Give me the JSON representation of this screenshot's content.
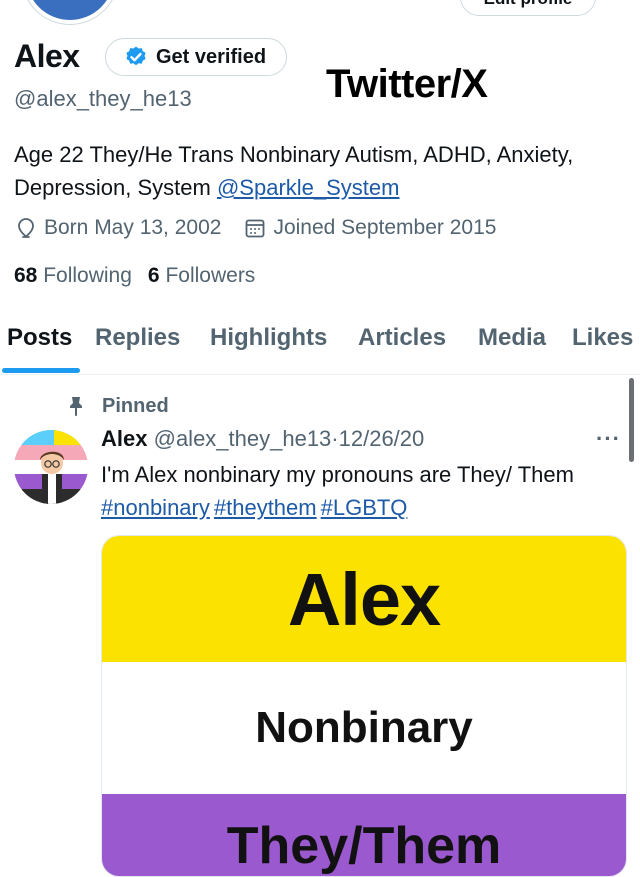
{
  "profile": {
    "edit_button_label": "Edit profile",
    "display_name": "Alex",
    "verify_label": "Get verified",
    "handle": "@alex_they_he13",
    "bio_text": "Age 22 They/He Trans Nonbinary Autism, ADHD, Anxiety, Depression, System ",
    "bio_mention": "@Sparkle_System",
    "born": "Born May 13, 2002",
    "joined": "Joined September 2015",
    "following_count": "68",
    "following_label": "Following",
    "followers_count": "6",
    "followers_label": "Followers"
  },
  "overlay": {
    "app_label": "Twitter/X"
  },
  "tabs": [
    {
      "label": "Posts"
    },
    {
      "label": "Replies"
    },
    {
      "label": "Highlights"
    },
    {
      "label": "Articles"
    },
    {
      "label": "Media"
    },
    {
      "label": "Likes"
    }
  ],
  "post": {
    "pinned_label": "Pinned",
    "author": "Alex",
    "handle": "@alex_they_he13",
    "separator": "·",
    "date": "12/26/20",
    "more_label": "···",
    "text": "I'm Alex nonbinary my pronouns are They/ Them ",
    "hashtags": [
      "#nonbinary",
      "#theythem",
      "#LGBTQ"
    ],
    "image": {
      "line1": "Alex",
      "line2": "Nonbinary",
      "line3": "They/Them"
    }
  },
  "icons": {
    "verified": "verified-check-icon",
    "location": "location-pin-icon",
    "calendar": "calendar-icon",
    "pin": "pin-icon",
    "more": "more-dots-icon"
  },
  "colors": {
    "accent": "#1d9bf0",
    "link": "#1d5aa8",
    "muted": "#536471",
    "flag_yellow": "#fbe200",
    "flag_purple": "#9b59d0"
  }
}
